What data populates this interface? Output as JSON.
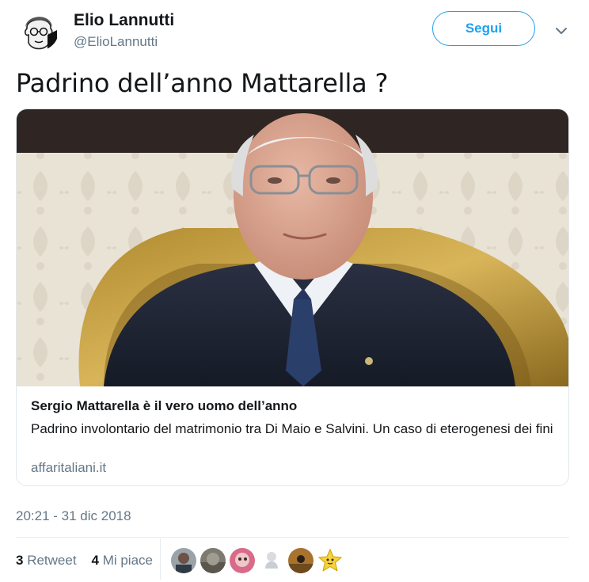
{
  "author": {
    "name": "Elio Lannutti",
    "handle": "@ElioLannutti",
    "avatar_icon": "caricature-avatar"
  },
  "follow_button": {
    "label": "Segui",
    "color": "#1da1f2"
  },
  "menu_icon": "chevron-down-icon",
  "tweet": {
    "text": "Padrino dell’anno Mattarella ?"
  },
  "card": {
    "image_icon": "portrait-photo",
    "title": "Sergio Mattarella è il vero uomo dell’anno",
    "description": "Padrino involontario del matrimonio tra Di Maio e Salvini. Un caso di eterogenesi dei fini",
    "domain": "affaritaliani.it"
  },
  "timestamp": "20:21 - 31 dic 2018",
  "stats": {
    "retweets_count": "3",
    "retweets_label": "Retweet",
    "likes_count": "4",
    "likes_label": "Mi piace"
  },
  "likers": [
    "user-avatar-1",
    "user-avatar-2",
    "user-avatar-3",
    "user-avatar-4",
    "user-avatar-5",
    "star-avatar-6"
  ]
}
